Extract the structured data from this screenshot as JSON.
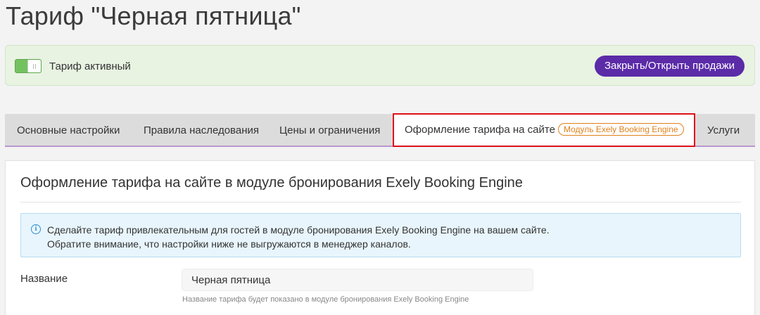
{
  "header": {
    "title": "Тариф \"Черная пятница\""
  },
  "status": {
    "label": "Тариф активный",
    "toggle_on": true,
    "sales_button": "Закрыть/Открыть продажи"
  },
  "tabs": [
    {
      "label": "Основные настройки"
    },
    {
      "label": "Правила наследования"
    },
    {
      "label": "Цены и ограничения"
    },
    {
      "label": "Оформление тарифа на сайте",
      "badge": "Модуль Exely Booking Engine",
      "active": true
    },
    {
      "label": "Услуги"
    }
  ],
  "section": {
    "title": "Оформление тарифа на сайте в модуле бронирования Exely Booking Engine",
    "info_line1": "Сделайте тариф привлекательным для гостей в модуле бронирования Exely Booking Engine на вашем сайте.",
    "info_line2": "Обратите внимание, что настройки ниже не выгружаются в менеджер каналов."
  },
  "form": {
    "name_label": "Название",
    "name_value": "Черная пятница",
    "name_hint": "Название тарифа будет показано в модуле бронирования Exely Booking Engine"
  },
  "colors": {
    "accent": "#5b2ba8",
    "active_green": "#6cb957",
    "highlight_red": "#e0101a",
    "badge_orange": "#e0801a",
    "info_blue": "#2e8fd0"
  }
}
